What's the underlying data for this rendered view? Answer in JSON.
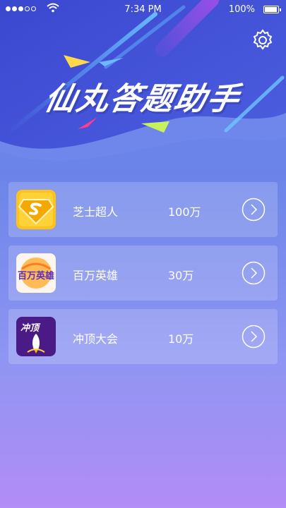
{
  "status_bar": {
    "time": "7:34 PM",
    "battery": "100%"
  },
  "header": {
    "title": "仙丸答题助手",
    "settings_icon": "gear-icon"
  },
  "apps": [
    {
      "name": "芝士超人",
      "prize": "100万",
      "icon": "cheese-superman-icon"
    },
    {
      "name": "百万英雄",
      "prize": "30万",
      "icon": "million-hero-icon",
      "icon_text": "百万英雄"
    },
    {
      "name": "冲顶大会",
      "prize": "10万",
      "icon": "chongding-rocket-icon",
      "icon_text": "冲顶"
    }
  ],
  "colors": {
    "bg_top": "#4d63dc",
    "bg_bottom": "#b28cf7"
  }
}
